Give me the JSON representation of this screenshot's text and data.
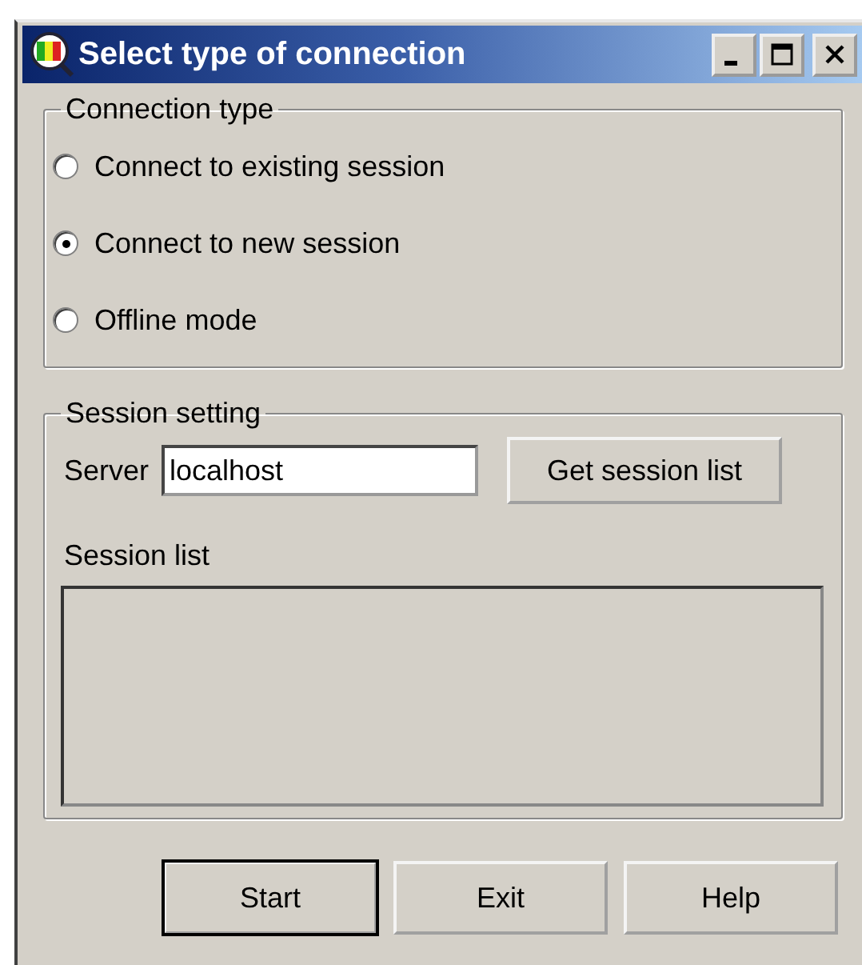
{
  "window": {
    "title": "Select type of connection"
  },
  "connection_type": {
    "label": "Connection type",
    "options": [
      {
        "label": "Connect to existing session",
        "selected": false
      },
      {
        "label": "Connect to new session",
        "selected": true
      },
      {
        "label": "Offline mode",
        "selected": false
      }
    ]
  },
  "session_setting": {
    "label": "Session setting",
    "server_label": "Server",
    "server_value": "localhost",
    "list_button": "Get session list",
    "list_label": "Session list"
  },
  "buttons": [
    {
      "label": "Start",
      "default": true
    },
    {
      "label": "Exit",
      "default": false
    },
    {
      "label": "Help",
      "default": false
    }
  ]
}
